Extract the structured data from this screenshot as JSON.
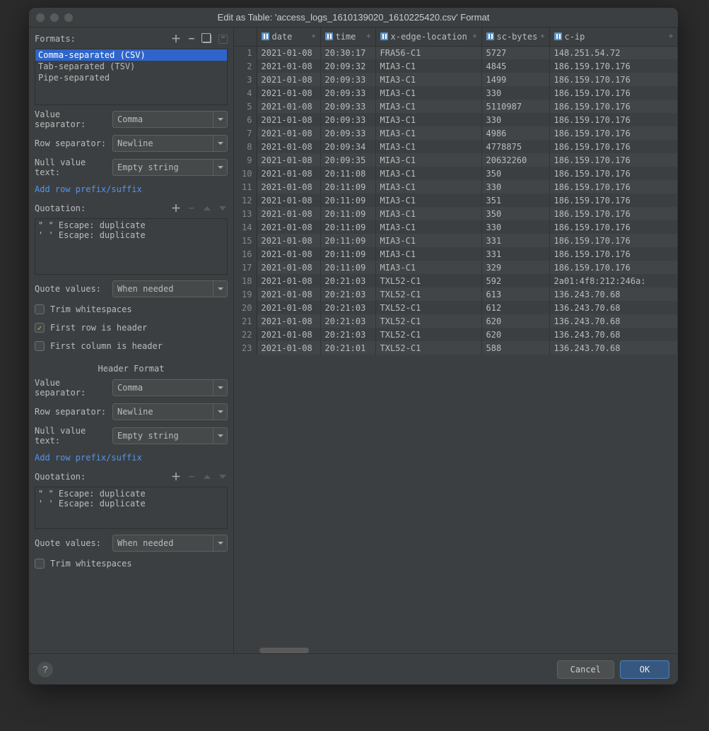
{
  "title": "Edit as Table: 'access_logs_1610139020_1610225420.csv' Format",
  "formats_label": "Formats:",
  "formats": [
    {
      "label": "Comma-separated (CSV)",
      "selected": true
    },
    {
      "label": "Tab-separated (TSV)",
      "selected": false
    },
    {
      "label": "Pipe-separated",
      "selected": false
    }
  ],
  "section": {
    "value_sep_label": "Value separator:",
    "value_sep": "Comma",
    "row_sep_label": "Row separator:",
    "row_sep": "Newline",
    "null_label": "Null value text:",
    "null_value": "Empty string",
    "add_prefix": "Add row prefix/suffix",
    "quotation_label": "Quotation:",
    "quotation_rules": [
      "\"  \"  Escape: duplicate",
      "'  '  Escape: duplicate"
    ],
    "quote_values_label": "Quote values:",
    "quote_values": "When needed",
    "trim_label": "Trim whitespaces",
    "first_row_header": "First row is header",
    "first_col_header": "First column is header"
  },
  "header_format_label": "Header Format",
  "columns": [
    "date",
    "time",
    "x-edge-location",
    "sc-bytes",
    "c-ip"
  ],
  "rows": [
    [
      "2021-01-08",
      "20:30:17",
      "FRA56-C1",
      "5727",
      "148.251.54.72"
    ],
    [
      "2021-01-08",
      "20:09:32",
      "MIA3-C1",
      "4845",
      "186.159.170.176"
    ],
    [
      "2021-01-08",
      "20:09:33",
      "MIA3-C1",
      "1499",
      "186.159.170.176"
    ],
    [
      "2021-01-08",
      "20:09:33",
      "MIA3-C1",
      "330",
      "186.159.170.176"
    ],
    [
      "2021-01-08",
      "20:09:33",
      "MIA3-C1",
      "5110987",
      "186.159.170.176"
    ],
    [
      "2021-01-08",
      "20:09:33",
      "MIA3-C1",
      "330",
      "186.159.170.176"
    ],
    [
      "2021-01-08",
      "20:09:33",
      "MIA3-C1",
      "4986",
      "186.159.170.176"
    ],
    [
      "2021-01-08",
      "20:09:34",
      "MIA3-C1",
      "4778875",
      "186.159.170.176"
    ],
    [
      "2021-01-08",
      "20:09:35",
      "MIA3-C1",
      "20632260",
      "186.159.170.176"
    ],
    [
      "2021-01-08",
      "20:11:08",
      "MIA3-C1",
      "350",
      "186.159.170.176"
    ],
    [
      "2021-01-08",
      "20:11:09",
      "MIA3-C1",
      "330",
      "186.159.170.176"
    ],
    [
      "2021-01-08",
      "20:11:09",
      "MIA3-C1",
      "351",
      "186.159.170.176"
    ],
    [
      "2021-01-08",
      "20:11:09",
      "MIA3-C1",
      "350",
      "186.159.170.176"
    ],
    [
      "2021-01-08",
      "20:11:09",
      "MIA3-C1",
      "330",
      "186.159.170.176"
    ],
    [
      "2021-01-08",
      "20:11:09",
      "MIA3-C1",
      "331",
      "186.159.170.176"
    ],
    [
      "2021-01-08",
      "20:11:09",
      "MIA3-C1",
      "331",
      "186.159.170.176"
    ],
    [
      "2021-01-08",
      "20:11:09",
      "MIA3-C1",
      "329",
      "186.159.170.176"
    ],
    [
      "2021-01-08",
      "20:21:03",
      "TXL52-C1",
      "592",
      "2a01:4f8:212:246a:"
    ],
    [
      "2021-01-08",
      "20:21:03",
      "TXL52-C1",
      "613",
      "136.243.70.68"
    ],
    [
      "2021-01-08",
      "20:21:03",
      "TXL52-C1",
      "612",
      "136.243.70.68"
    ],
    [
      "2021-01-08",
      "20:21:03",
      "TXL52-C1",
      "620",
      "136.243.70.68"
    ],
    [
      "2021-01-08",
      "20:21:03",
      "TXL52-C1",
      "620",
      "136.243.70.68"
    ],
    [
      "2021-01-08",
      "20:21:01",
      "TXL52-C1",
      "588",
      "136.243.70.68"
    ]
  ],
  "footer": {
    "cancel": "Cancel",
    "ok": "OK"
  }
}
